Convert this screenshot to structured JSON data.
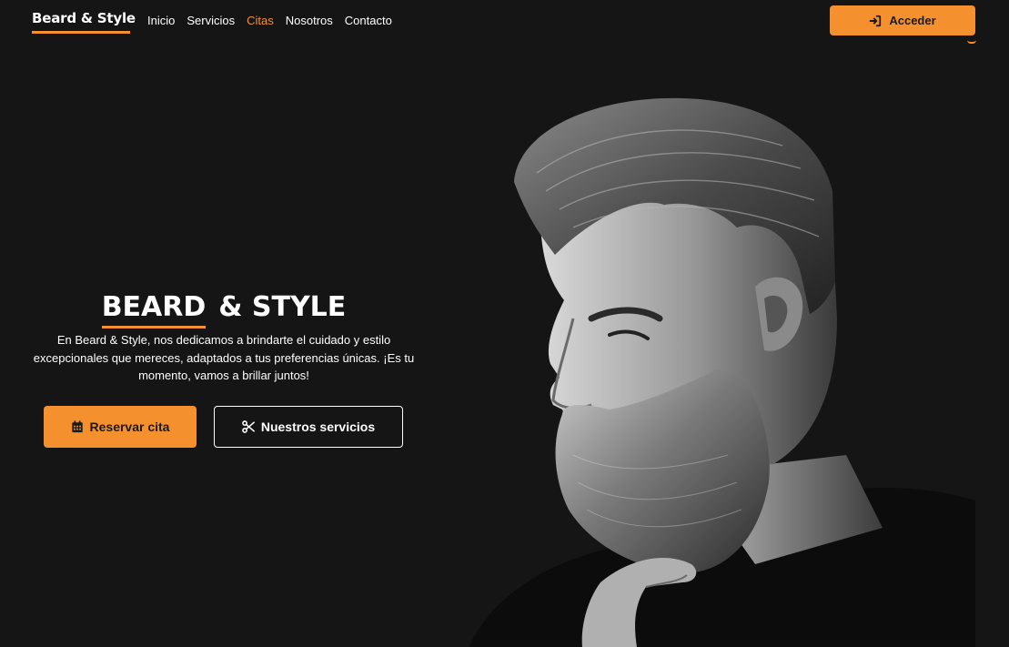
{
  "navbar": {
    "brand": "Beard & Style",
    "links": [
      {
        "label": "Inicio",
        "active": false
      },
      {
        "label": "Servicios",
        "active": false
      },
      {
        "label": "Citas",
        "active": true
      },
      {
        "label": "Nosotros",
        "active": false
      },
      {
        "label": "Contacto",
        "active": false
      }
    ],
    "login_label": "Acceder",
    "login_icon": "sign-in-icon"
  },
  "hero": {
    "title_word1": "BEARD",
    "title_word2": "& STYLE",
    "description": "En Beard & Style, nos dedicamos a brindarte el cuidado y estilo excepcionales que mereces, adaptados a tus preferencias únicas. ¡Es tu momento, vamos a brillar juntos!",
    "reserve_label": "Reservar cita",
    "reserve_icon": "calendar-icon",
    "services_label": "Nuestros servicios",
    "services_icon": "scissors-icon"
  },
  "colors": {
    "accent": "#f5902f",
    "background": "#151515",
    "text": "#ffffff"
  }
}
